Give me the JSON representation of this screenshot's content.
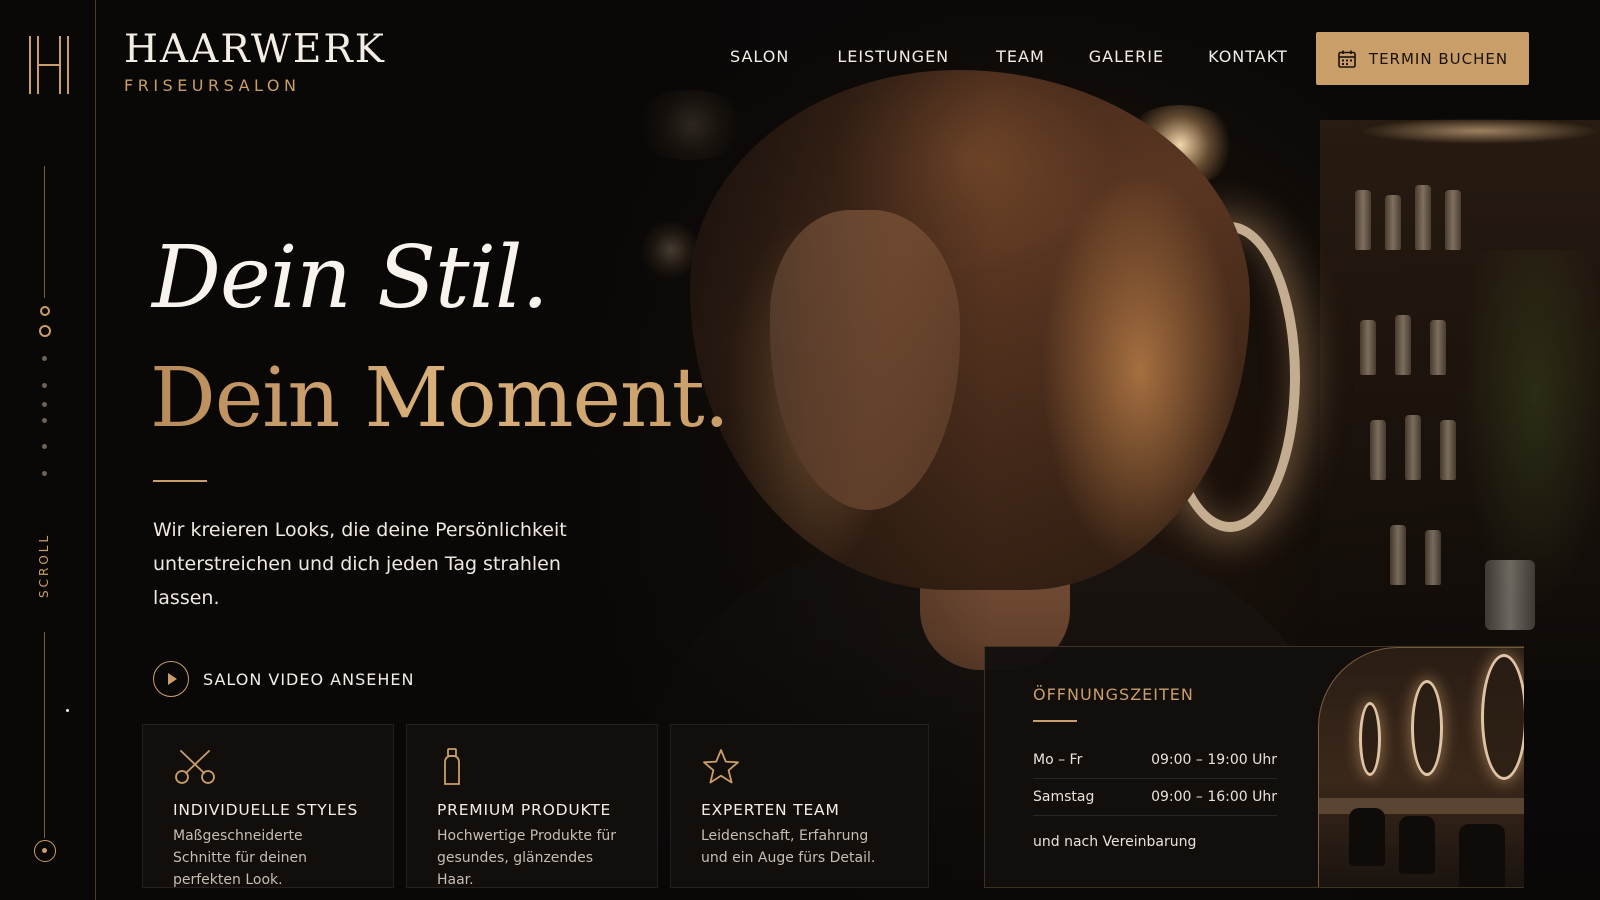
{
  "brand": {
    "name": "HAARWERK",
    "subtitle": "FRISEURSALON"
  },
  "nav": {
    "items": [
      {
        "label": "SALON"
      },
      {
        "label": "LEISTUNGEN"
      },
      {
        "label": "TEAM"
      },
      {
        "label": "GALERIE"
      },
      {
        "label": "KONTAKT"
      }
    ],
    "cta_label": "TERMIN BUCHEN"
  },
  "rail": {
    "scroll_label": "SCROLL"
  },
  "hero": {
    "script_line": "Dein Stil.",
    "title": "Dein Moment.",
    "description": "Wir kreieren Looks, die deine Persönlichkeit unterstreichen und dich jeden Tag strahlen lassen.",
    "video_label": "SALON VIDEO ANSEHEN"
  },
  "features": [
    {
      "icon": "scissors-icon",
      "title": "INDIVIDUELLE STYLES",
      "text": "Maßgeschneiderte Schnitte für deinen perfekten Look."
    },
    {
      "icon": "bottle-icon",
      "title": "PREMIUM PRODUKTE",
      "text": "Hochwertige Produkte für gesundes, glänzendes Haar."
    },
    {
      "icon": "star-icon",
      "title": "EXPERTEN TEAM",
      "text": "Leidenschaft, Erfahrung und ein Auge fürs Detail."
    }
  ],
  "hours": {
    "title": "ÖFFNUNGSZEITEN",
    "rows": [
      {
        "day": "Mo – Fr",
        "time": "09:00 – 19:00 Uhr"
      },
      {
        "day": "Samstag",
        "time": "09:00 – 16:00 Uhr"
      }
    ],
    "note": "und nach Vereinbarung"
  },
  "colors": {
    "accent": "#c99e68",
    "background": "#0b0908",
    "text": "#f4ede4"
  }
}
